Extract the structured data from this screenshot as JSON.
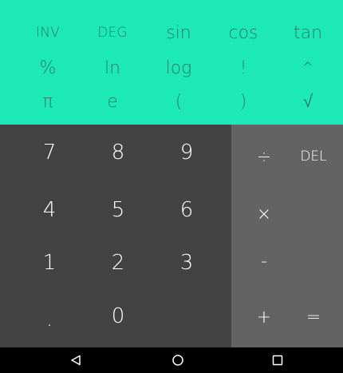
{
  "colors": {
    "scientific_pad": "#1de9b6",
    "scientific_text": "#2a7a66",
    "numeric_pad": "#434343",
    "operator_pad": "#636363",
    "button_text": "#ffffff",
    "nav_bar": "#000000"
  },
  "scientific": {
    "row1": [
      "INV",
      "DEG",
      "sin",
      "cos",
      "tan"
    ],
    "row2": [
      "%",
      "ln",
      "log",
      "!",
      "^"
    ],
    "row3": [
      "π",
      "e",
      "(",
      ")",
      "√"
    ]
  },
  "numeric": {
    "row1": [
      "7",
      "8",
      "9"
    ],
    "row2": [
      "4",
      "5",
      "6"
    ],
    "row3": [
      "1",
      "2",
      "3"
    ],
    "row4": [
      ".",
      "0"
    ]
  },
  "operators": {
    "divide": "÷",
    "delete": "DEL",
    "multiply": "×",
    "subtract": "-",
    "add": "+",
    "equals": "="
  },
  "nav": {
    "icons": [
      "back-icon",
      "home-icon",
      "recents-icon"
    ]
  }
}
